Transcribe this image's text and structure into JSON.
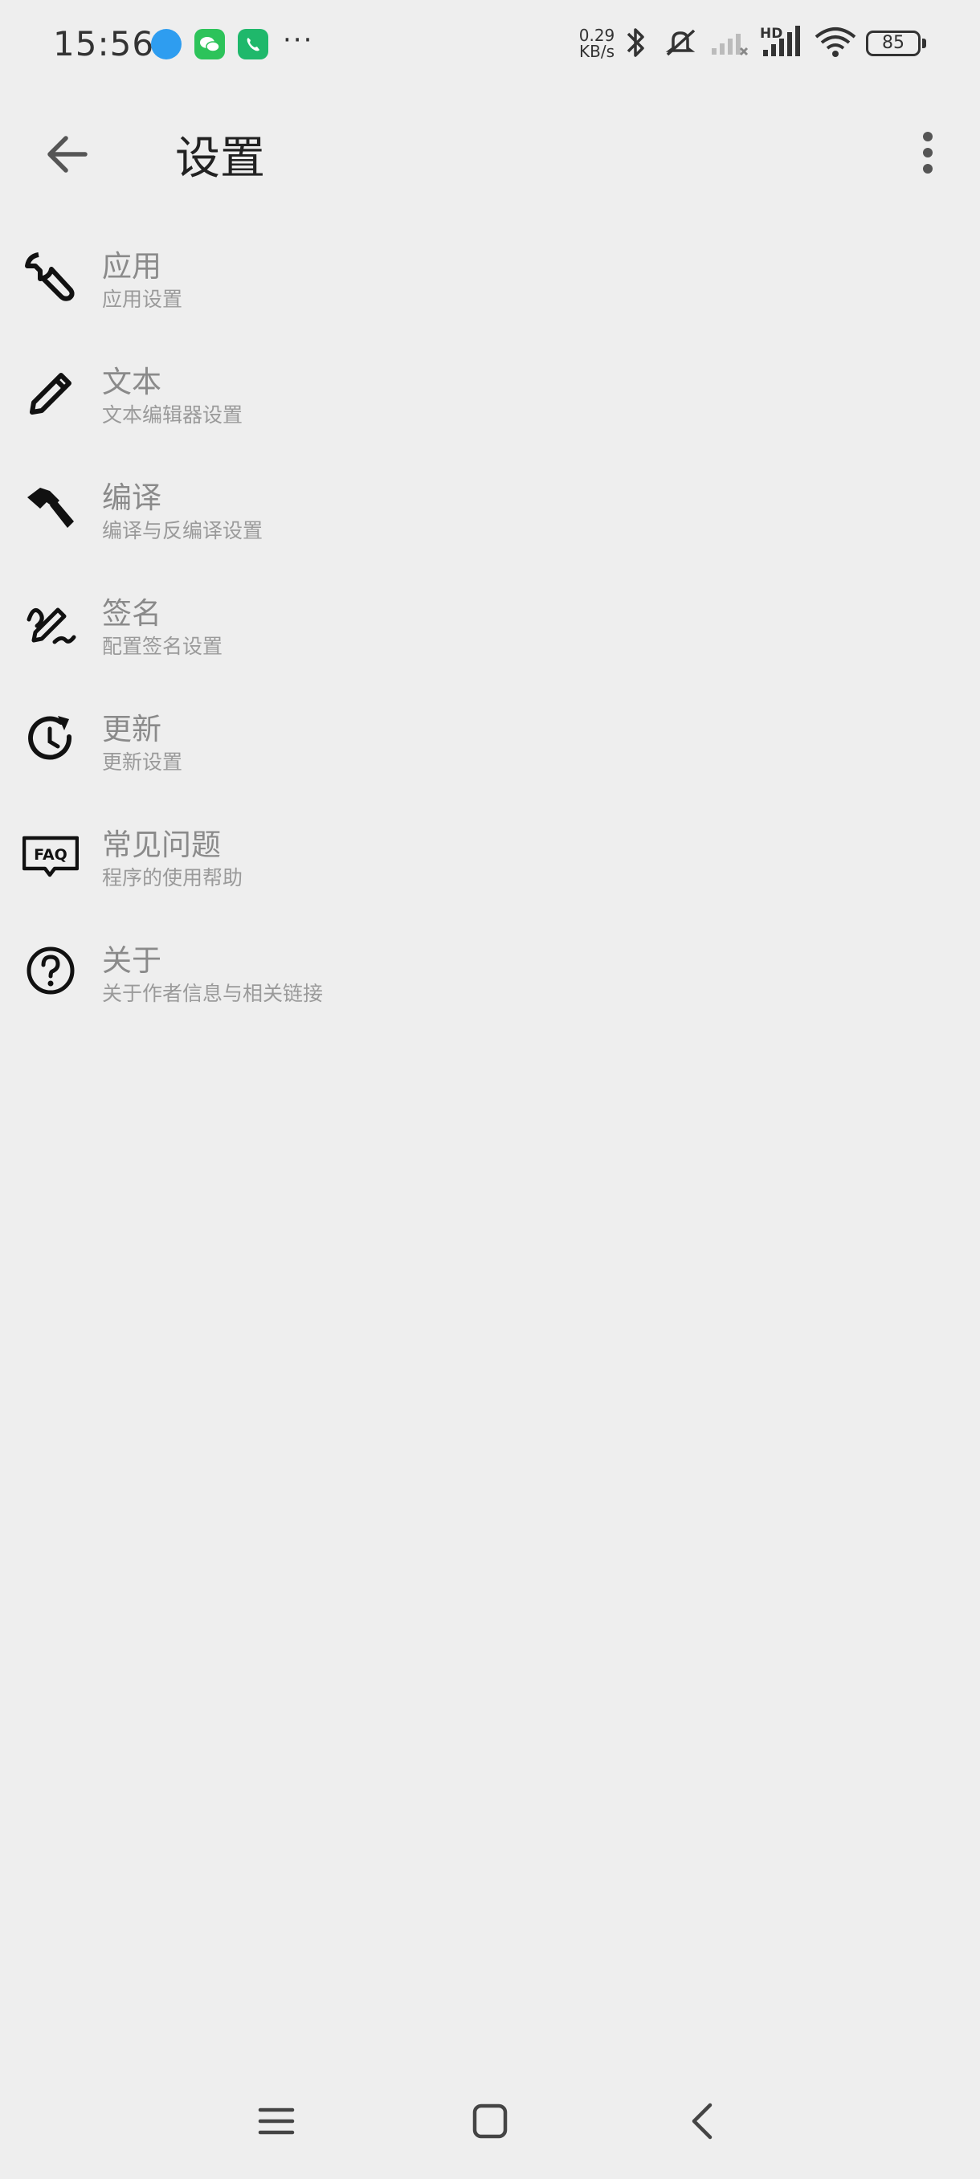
{
  "status_bar": {
    "time": "15:56",
    "network_speed_value": "0.29",
    "network_speed_unit": "KB/s",
    "network_type": "HD",
    "battery": "85",
    "icons": [
      "browser-app-icon",
      "wechat-app-icon",
      "phone-app-icon",
      "more-notifications-icon",
      "bluetooth-icon",
      "mute-icon",
      "signal-weak-icon",
      "signal-hd-icon",
      "wifi-icon",
      "battery-icon"
    ],
    "colors": {
      "browser": "#2e9df0",
      "wechat": "#2dc35a",
      "phone": "#1fb86b"
    }
  },
  "app_bar": {
    "title": "设置",
    "back_icon": "arrow-back-icon",
    "menu_icon": "more-vert-icon"
  },
  "settings": [
    {
      "icon": "wrench-icon",
      "title": "应用",
      "subtitle": "应用设置"
    },
    {
      "icon": "pencil-icon",
      "title": "文本",
      "subtitle": "文本编辑器设置"
    },
    {
      "icon": "hammer-icon",
      "title": "编译",
      "subtitle": "编译与反编译设置"
    },
    {
      "icon": "signature-icon",
      "title": "签名",
      "subtitle": "配置签名设置"
    },
    {
      "icon": "update-icon",
      "title": "更新",
      "subtitle": "更新设置"
    },
    {
      "icon": "faq-icon",
      "title": "常见问题",
      "subtitle": "程序的使用帮助"
    },
    {
      "icon": "help-icon",
      "title": "关于",
      "subtitle": "关于作者信息与相关链接"
    }
  ],
  "nav_bar": {
    "icons": [
      "menu-icon",
      "home-icon",
      "back-icon"
    ]
  }
}
